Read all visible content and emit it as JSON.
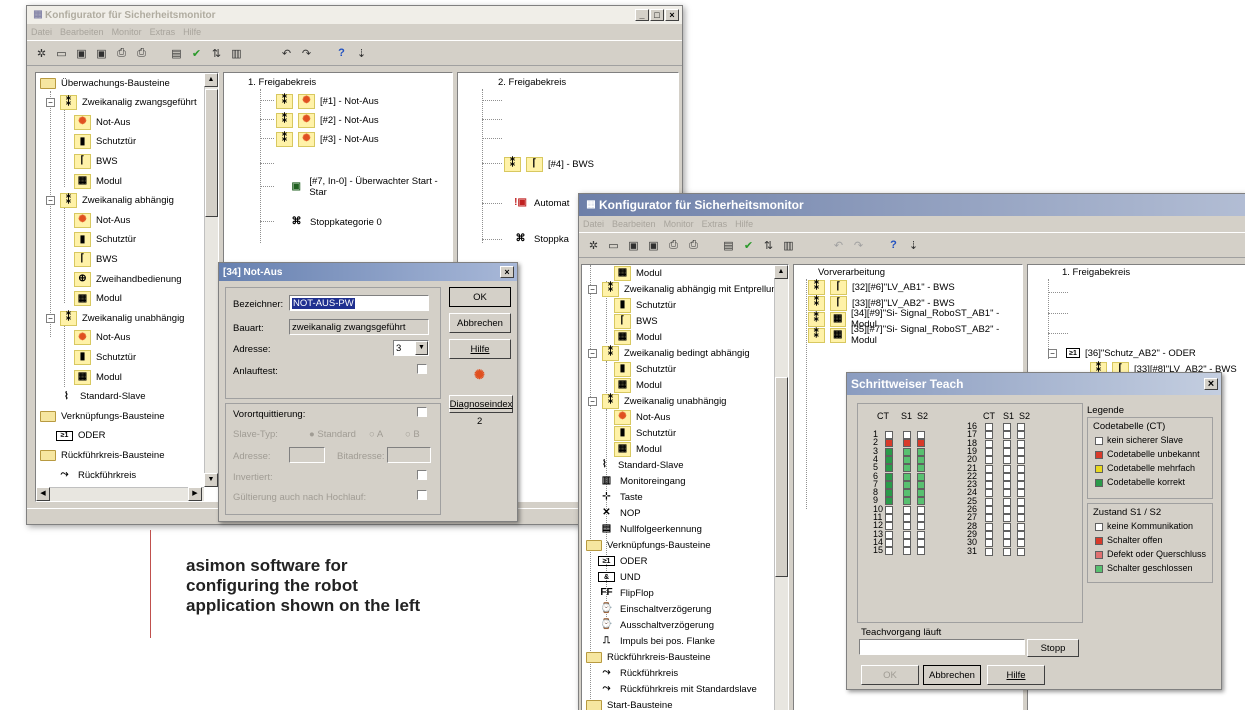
{
  "left_window": {
    "title": "Konfigurator für Sicherheitsmonitor",
    "menu": [
      "Datei",
      "Bearbeiten",
      "Monitor",
      "Extras",
      "Hilfe"
    ],
    "window_buttons": [
      "_",
      "□",
      "×"
    ],
    "tree": [
      {
        "label": "Überwachungs-Bausteine",
        "icon": "folder-icon"
      },
      {
        "label": "Zweikanalig zwangsgeführt",
        "icon": "two-channel-icon"
      },
      {
        "label": "Not-Aus",
        "icon": "emergency-stop-icon"
      },
      {
        "label": "Schutztür",
        "icon": "safety-door-icon"
      },
      {
        "label": "BWS",
        "icon": "light-curtain-icon"
      },
      {
        "label": "Modul",
        "icon": "module-icon"
      },
      {
        "label": "Zweikanalig abhängig",
        "icon": "two-channel-icon"
      },
      {
        "label": "Not-Aus",
        "icon": "emergency-stop-icon"
      },
      {
        "label": "Schutztür",
        "icon": "safety-door-icon"
      },
      {
        "label": "BWS",
        "icon": "light-curtain-icon"
      },
      {
        "label": "Zweihandbedienung",
        "icon": "two-hand-icon"
      },
      {
        "label": "Modul",
        "icon": "module-icon"
      },
      {
        "label": "Zweikanalig unabhängig",
        "icon": "two-channel-icon"
      },
      {
        "label": "Not-Aus",
        "icon": "emergency-stop-icon"
      },
      {
        "label": "Schutztür",
        "icon": "safety-door-icon"
      },
      {
        "label": "Modul",
        "icon": "module-icon"
      },
      {
        "label": "Standard-Slave",
        "icon": "slave-icon"
      },
      {
        "label": "Verknüpfungs-Bausteine",
        "icon": "folder-icon"
      },
      {
        "label": "ODER",
        "icon": "or-gate-icon"
      },
      {
        "label": "Rückführkreis-Bausteine",
        "icon": "folder-icon"
      },
      {
        "label": "Rückführkreis",
        "icon": "feedback-icon"
      }
    ],
    "circuit1": {
      "header": "1. Freigabekreis",
      "items": [
        "[#1] - Not-Aus",
        "[#2] - Not-Aus",
        "[#3] - Not-Aus",
        "[#7, In-0] - Überwachter Start - Star",
        "Stoppkategorie 0"
      ]
    },
    "circuit2": {
      "header": "2. Freigabekreis",
      "items": [
        "[#4] - BWS",
        "Automat",
        "Stoppka"
      ]
    }
  },
  "notaus_dialog": {
    "title": "[34] Not-Aus",
    "bezeichner_label": "Bezeichner:",
    "bezeichner_value": "NOT-AUS-PW",
    "bauart_label": "Bauart:",
    "bauart_value": "zweikanalig zwangsgeführt",
    "adresse_label": "Adresse:",
    "adresse_value": "3",
    "anlauftest_label": "Anlauftest:",
    "vorort_label": "Vorortquittierung:",
    "slave_typ_label": "Slave-Typ:",
    "radio_standard": "Standard",
    "radio_a": "A",
    "radio_b": "B",
    "adresse2_label": "Adresse:",
    "bitadresse_label": "Bitadresse:",
    "invertiert_label": "Invertiert:",
    "gultierung_label": "Gültierung auch nach Hochlauf:",
    "ok": "OK",
    "abbrechen": "Abbrechen",
    "hilfe": "Hilfe",
    "diagnose_label": "Diagnoseindex",
    "diagnose_value": "2"
  },
  "right_window": {
    "title": "Konfigurator für Sicherheitsmonitor",
    "menu": [
      "Datei",
      "Bearbeiten",
      "Monitor",
      "Extras",
      "Hilfe"
    ],
    "tree": [
      {
        "label": "Modul",
        "icon": "module-icon"
      },
      {
        "label": "Zweikanalig abhängig mit Entprellung",
        "icon": "two-channel-icon"
      },
      {
        "label": "Schutztür",
        "icon": "safety-door-icon"
      },
      {
        "label": "BWS",
        "icon": "light-curtain-icon"
      },
      {
        "label": "Modul",
        "icon": "module-icon"
      },
      {
        "label": "Zweikanalig bedingt abhängig",
        "icon": "two-channel-icon"
      },
      {
        "label": "Schutztür",
        "icon": "safety-door-icon"
      },
      {
        "label": "Modul",
        "icon": "module-icon"
      },
      {
        "label": "Zweikanalig unabhängig",
        "icon": "two-channel-icon"
      },
      {
        "label": "Not-Aus",
        "icon": "emergency-stop-icon"
      },
      {
        "label": "Schutztür",
        "icon": "safety-door-icon"
      },
      {
        "label": "Modul",
        "icon": "module-icon"
      },
      {
        "label": "Standard-Slave",
        "icon": "slave-icon"
      },
      {
        "label": "Monitoreingang",
        "icon": "monitor-input-icon"
      },
      {
        "label": "Taste",
        "icon": "button-key-icon"
      },
      {
        "label": "NOP",
        "icon": "nop-icon"
      },
      {
        "label": "Nullfolgeerkennung",
        "icon": "zero-sequence-icon"
      },
      {
        "label": "Verknüpfungs-Bausteine",
        "icon": "folder-icon"
      },
      {
        "label": "ODER",
        "icon": "or-gate-icon"
      },
      {
        "label": "UND",
        "icon": "and-gate-icon"
      },
      {
        "label": "FlipFlop",
        "icon": "flipflop-icon"
      },
      {
        "label": "Einschaltverzögerung",
        "icon": "on-delay-icon"
      },
      {
        "label": "Ausschaltverzögerung",
        "icon": "off-delay-icon"
      },
      {
        "label": "Impuls bei pos. Flanke",
        "icon": "pulse-icon"
      },
      {
        "label": "Rückführkreis-Bausteine",
        "icon": "folder-icon"
      },
      {
        "label": "Rückführkreis",
        "icon": "feedback-icon"
      },
      {
        "label": "Rückführkreis mit Standardslave",
        "icon": "feedback-icon"
      },
      {
        "label": "Start-Bausteine",
        "icon": "folder-icon"
      }
    ],
    "vorverarbeitung": {
      "header": "Vorverarbeitung",
      "items": [
        "[32][#6]\"LV_AB1\" - BWS",
        "[33][#8]\"LV_AB2\" - BWS",
        "[34][#9]\"Si- Signal_RoboST_AB1\" - Modul",
        "[35][#7]\"Si- Signal_RoboST_AB2\" - Modul"
      ]
    },
    "freigabe1": {
      "header": "1. Freigabekreis",
      "items": [
        "[36]\"Schutz_AB2\" - ODER",
        "[33][#8]\"LV_AB2\" - BWS"
      ]
    }
  },
  "teach_dialog": {
    "title": "Schrittweiser Teach",
    "col_headers": [
      "CT",
      "S1",
      "S2"
    ],
    "left_rows": [
      1,
      2,
      3,
      4,
      5,
      6,
      7,
      8,
      9,
      10,
      11,
      12,
      13,
      14,
      15
    ],
    "right_rows": [
      16,
      17,
      18,
      19,
      20,
      21,
      22,
      23,
      24,
      25,
      26,
      27,
      28,
      29,
      30,
      31
    ],
    "status_text": "Teachvorgang läuft",
    "stopp": "Stopp",
    "ok": "OK",
    "abbrechen": "Abbrechen",
    "hilfe": "Hilfe",
    "legend_title": "Legende",
    "ct_title": "Codetabelle (CT)",
    "ct_items": [
      "kein sicherer Slave",
      "Codetabelle unbekannt",
      "Codetabelle mehrfach",
      "Codetabelle korrekt"
    ],
    "s_title": "Zustand S1 / S2",
    "s_items": [
      "keine Kommunikation",
      "Schalter offen",
      "Defekt oder Querschluss",
      "Schalter geschlossen"
    ],
    "colors": {
      "none": "#ffffff",
      "red": "#d83a2a",
      "yellow": "#e8d820",
      "green": "#2a9a4a",
      "lightgreen": "#58c070"
    }
  },
  "caption": {
    "line1": "asimon software for",
    "line2": "configuring the robot",
    "line3": "application shown on the left"
  }
}
